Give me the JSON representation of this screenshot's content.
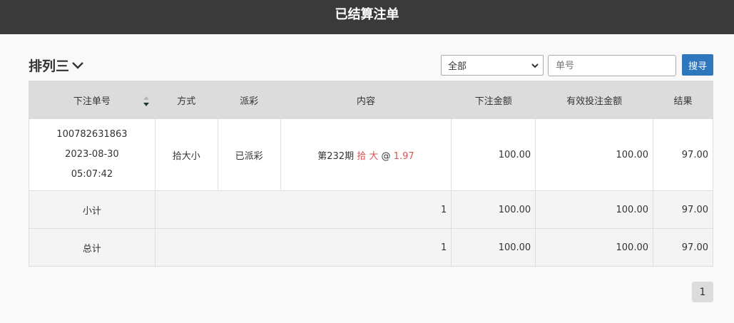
{
  "header": {
    "title": "已结算注单"
  },
  "toolbar": {
    "game_name": "排列三",
    "filter_selected": "全部",
    "order_placeholder": "单号",
    "search_label": "搜寻"
  },
  "table": {
    "columns": [
      "下注单号",
      "方式",
      "派彩",
      "内容",
      "下注金额",
      "有效投注金额",
      "结果"
    ],
    "rows": [
      {
        "order_no": "100782631863",
        "date": "2023-08-30",
        "time": "05:07:42",
        "method": "拾大小",
        "payout": "已派彩",
        "content_prefix": "第232期",
        "content_pick": "拾 大",
        "content_at": "@",
        "content_odds": "1.97",
        "amount": "100.00",
        "valid_amount": "100.00",
        "result": "97.00"
      }
    ],
    "subtotal": {
      "label": "小计",
      "count": "1",
      "amount": "100.00",
      "valid_amount": "100.00",
      "result": "97.00"
    },
    "total": {
      "label": "总计",
      "count": "1",
      "amount": "100.00",
      "valid_amount": "100.00",
      "result": "97.00"
    }
  },
  "pagination": {
    "current": "1"
  },
  "colors": {
    "header_bg": "#3a3a3a",
    "search_btn": "#2e77bc",
    "highlight_red": "#d9534f"
  }
}
